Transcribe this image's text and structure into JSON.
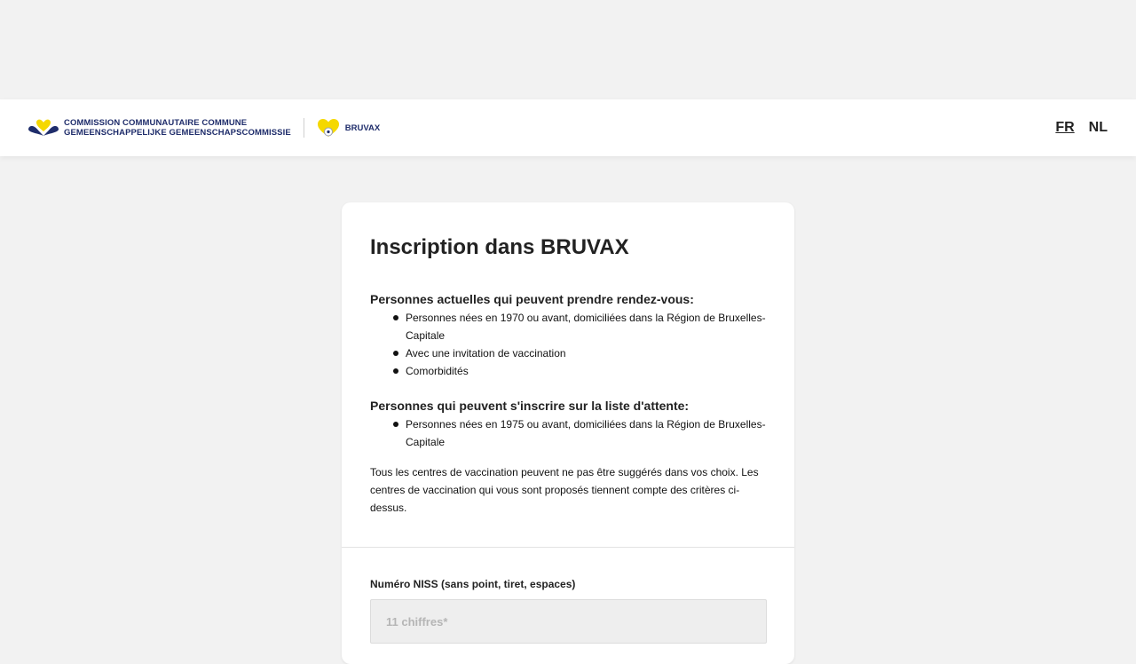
{
  "header": {
    "org_line1": "COMMISSION COMMUNAUTAIRE COMMUNE",
    "org_line2": "GEMEENSCHAPPELIJKE GEMEENSCHAPSCOMMISSIE",
    "app_name": "BRUVAX",
    "languages": [
      {
        "label": "FR",
        "active": true
      },
      {
        "label": "NL",
        "active": false
      }
    ]
  },
  "card": {
    "title": "Inscription dans BRUVAX",
    "eligible_heading": "Personnes actuelles qui peuvent prendre rendez-vous:",
    "eligible_items": [
      "Personnes nées en 1970 ou avant, domiciliées dans la Région de Bruxelles-Capitale",
      "Avec une invitation de vaccination",
      "Comorbidités"
    ],
    "waitlist_heading": "Personnes qui peuvent s'inscrire sur la liste d'attente:",
    "waitlist_items": [
      "Personnes nées en 1975 ou avant, domiciliées dans la Région de Bruxelles-Capitale"
    ],
    "note": "Tous les centres de vaccination peuvent ne pas être suggérés dans vos choix. Les centres de vaccination qui vous sont proposés tiennent compte des critères ci-dessus."
  },
  "form": {
    "niss_label": "Numéro NISS (sans point, tiret, espaces)",
    "niss_placeholder": "11 chiffres*",
    "niss_value": ""
  },
  "colors": {
    "brand_navy": "#1f2d6b",
    "brand_yellow": "#f5d800",
    "page_bg": "#f2f2f2"
  },
  "icons": {
    "org_logo": "hearts-logo-icon",
    "app_logo": "bruvax-heart-icon"
  }
}
